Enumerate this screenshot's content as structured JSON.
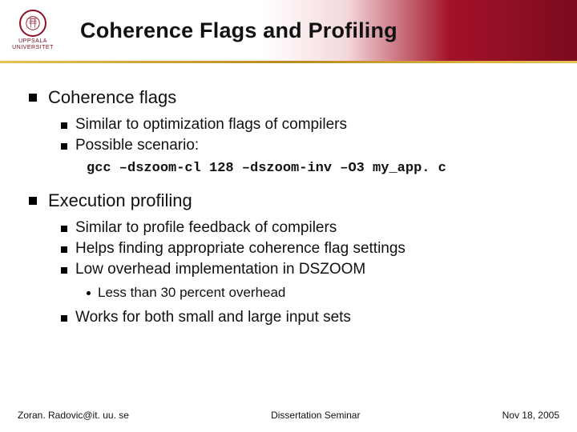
{
  "logo": {
    "line1": "UPPSALA",
    "line2": "UNIVERSITET"
  },
  "title": "Coherence Flags and Profiling",
  "sections": [
    {
      "heading": "Coherence flags",
      "items": [
        "Similar to optimization flags of compilers",
        "Possible scenario:"
      ],
      "code": "gcc –dszoom-cl 128 –dszoom-inv –O3 my_app. c"
    },
    {
      "heading": "Execution profiling",
      "items": [
        "Similar to profile feedback of compilers",
        "Helps finding appropriate coherence flag settings",
        "Low overhead implementation in DSZOOM",
        "Works for both small and large input sets"
      ],
      "subitems_after_index": 2,
      "subitems": [
        "Less than 30 percent overhead"
      ]
    }
  ],
  "footer": {
    "left": "Zoran. Radovic@it. uu. se",
    "center": "Dissertation Seminar",
    "right": "Nov 18, 2005"
  }
}
